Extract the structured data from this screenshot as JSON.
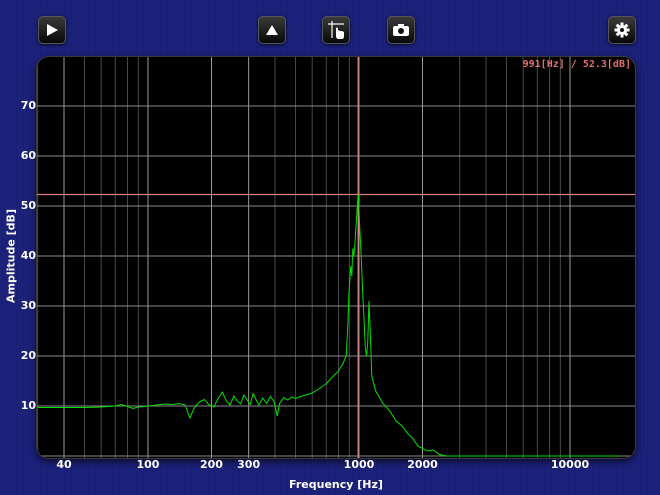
{
  "toolbar": {
    "buttons": [
      {
        "name": "play-button",
        "icon": "play-icon"
      },
      {
        "name": "up-button",
        "icon": "triangle-up-icon"
      },
      {
        "name": "cursor-button",
        "icon": "cursor-hand-icon"
      },
      {
        "name": "camera-button",
        "icon": "camera-icon"
      },
      {
        "name": "settings-button",
        "icon": "gear-icon"
      }
    ]
  },
  "cursor_readout": "991[Hz] / 52.3[dB]",
  "colors": {
    "background": "#1a1f78",
    "plot_bg": "#000000",
    "grid": "#8a8a8a",
    "trace": "#00e000",
    "cursor": "#d88080"
  },
  "chart_data": {
    "type": "line",
    "xlabel": "Frequency [Hz]",
    "ylabel": "Amplitude [dB]",
    "x_scale": "log",
    "xlim": [
      30,
      17000
    ],
    "ylim": [
      0,
      78
    ],
    "x_ticks": [
      40,
      100,
      200,
      300,
      1000,
      2000,
      10000
    ],
    "x_tick_labels": [
      "40",
      "100",
      "200",
      "300",
      "1000",
      "2000",
      "10000"
    ],
    "y_ticks": [
      10,
      20,
      30,
      40,
      50,
      60,
      70
    ],
    "y_tick_labels": [
      "10",
      "20",
      "30",
      "40",
      "50",
      "60",
      "70"
    ],
    "grid": true,
    "cursor": {
      "x": 991,
      "y": 52.3
    },
    "series": [
      {
        "points": [
          [
            30,
            9.7
          ],
          [
            40,
            9.7
          ],
          [
            50,
            9.7
          ],
          [
            60,
            9.8
          ],
          [
            70,
            10.0
          ],
          [
            75,
            10.3
          ],
          [
            80,
            9.9
          ],
          [
            85,
            9.5
          ],
          [
            90,
            9.8
          ],
          [
            100,
            10.0
          ],
          [
            110,
            10.2
          ],
          [
            120,
            10.4
          ],
          [
            130,
            10.3
          ],
          [
            140,
            10.5
          ],
          [
            150,
            10.2
          ],
          [
            158,
            7.6
          ],
          [
            165,
            9.5
          ],
          [
            175,
            10.8
          ],
          [
            185,
            11.3
          ],
          [
            195,
            10.2
          ],
          [
            205,
            9.8
          ],
          [
            215,
            11.5
          ],
          [
            225,
            12.8
          ],
          [
            235,
            11.0
          ],
          [
            245,
            10.2
          ],
          [
            255,
            12.0
          ],
          [
            265,
            11.0
          ],
          [
            275,
            10.4
          ],
          [
            285,
            12.2
          ],
          [
            295,
            11.2
          ],
          [
            305,
            10.3
          ],
          [
            315,
            12.5
          ],
          [
            325,
            11.3
          ],
          [
            335,
            10.2
          ],
          [
            350,
            11.6
          ],
          [
            365,
            10.5
          ],
          [
            380,
            11.9
          ],
          [
            395,
            10.9
          ],
          [
            410,
            8.0
          ],
          [
            420,
            10.5
          ],
          [
            440,
            11.7
          ],
          [
            460,
            11.2
          ],
          [
            480,
            11.8
          ],
          [
            500,
            11.5
          ],
          [
            530,
            11.9
          ],
          [
            560,
            12.2
          ],
          [
            600,
            12.6
          ],
          [
            650,
            13.5
          ],
          [
            700,
            14.5
          ],
          [
            750,
            15.8
          ],
          [
            800,
            17.0
          ],
          [
            840,
            18.5
          ],
          [
            870,
            20.0
          ],
          [
            885,
            26.0
          ],
          [
            895,
            32.0
          ],
          [
            905,
            35.0
          ],
          [
            915,
            38.0
          ],
          [
            925,
            36.0
          ],
          [
            935,
            41.5
          ],
          [
            945,
            40.0
          ],
          [
            955,
            42.0
          ],
          [
            965,
            45.0
          ],
          [
            975,
            48.0
          ],
          [
            985,
            51.0
          ],
          [
            991,
            52.3
          ],
          [
            998,
            50.0
          ],
          [
            1010,
            45.0
          ],
          [
            1025,
            40.0
          ],
          [
            1040,
            33.0
          ],
          [
            1055,
            28.0
          ],
          [
            1070,
            22.0
          ],
          [
            1085,
            20.0
          ],
          [
            1100,
            22.5
          ],
          [
            1115,
            31.0
          ],
          [
            1130,
            25.0
          ],
          [
            1150,
            16.0
          ],
          [
            1200,
            13.0
          ],
          [
            1300,
            10.5
          ],
          [
            1400,
            9.0
          ],
          [
            1500,
            7.0
          ],
          [
            1600,
            6.0
          ],
          [
            1700,
            4.5
          ],
          [
            1800,
            3.5
          ],
          [
            1900,
            2.0
          ],
          [
            2000,
            1.5
          ],
          [
            2100,
            1.0
          ],
          [
            2250,
            1.2
          ],
          [
            2400,
            0.3
          ],
          [
            2600,
            0.0
          ],
          [
            17000,
            0.0
          ]
        ]
      }
    ]
  }
}
